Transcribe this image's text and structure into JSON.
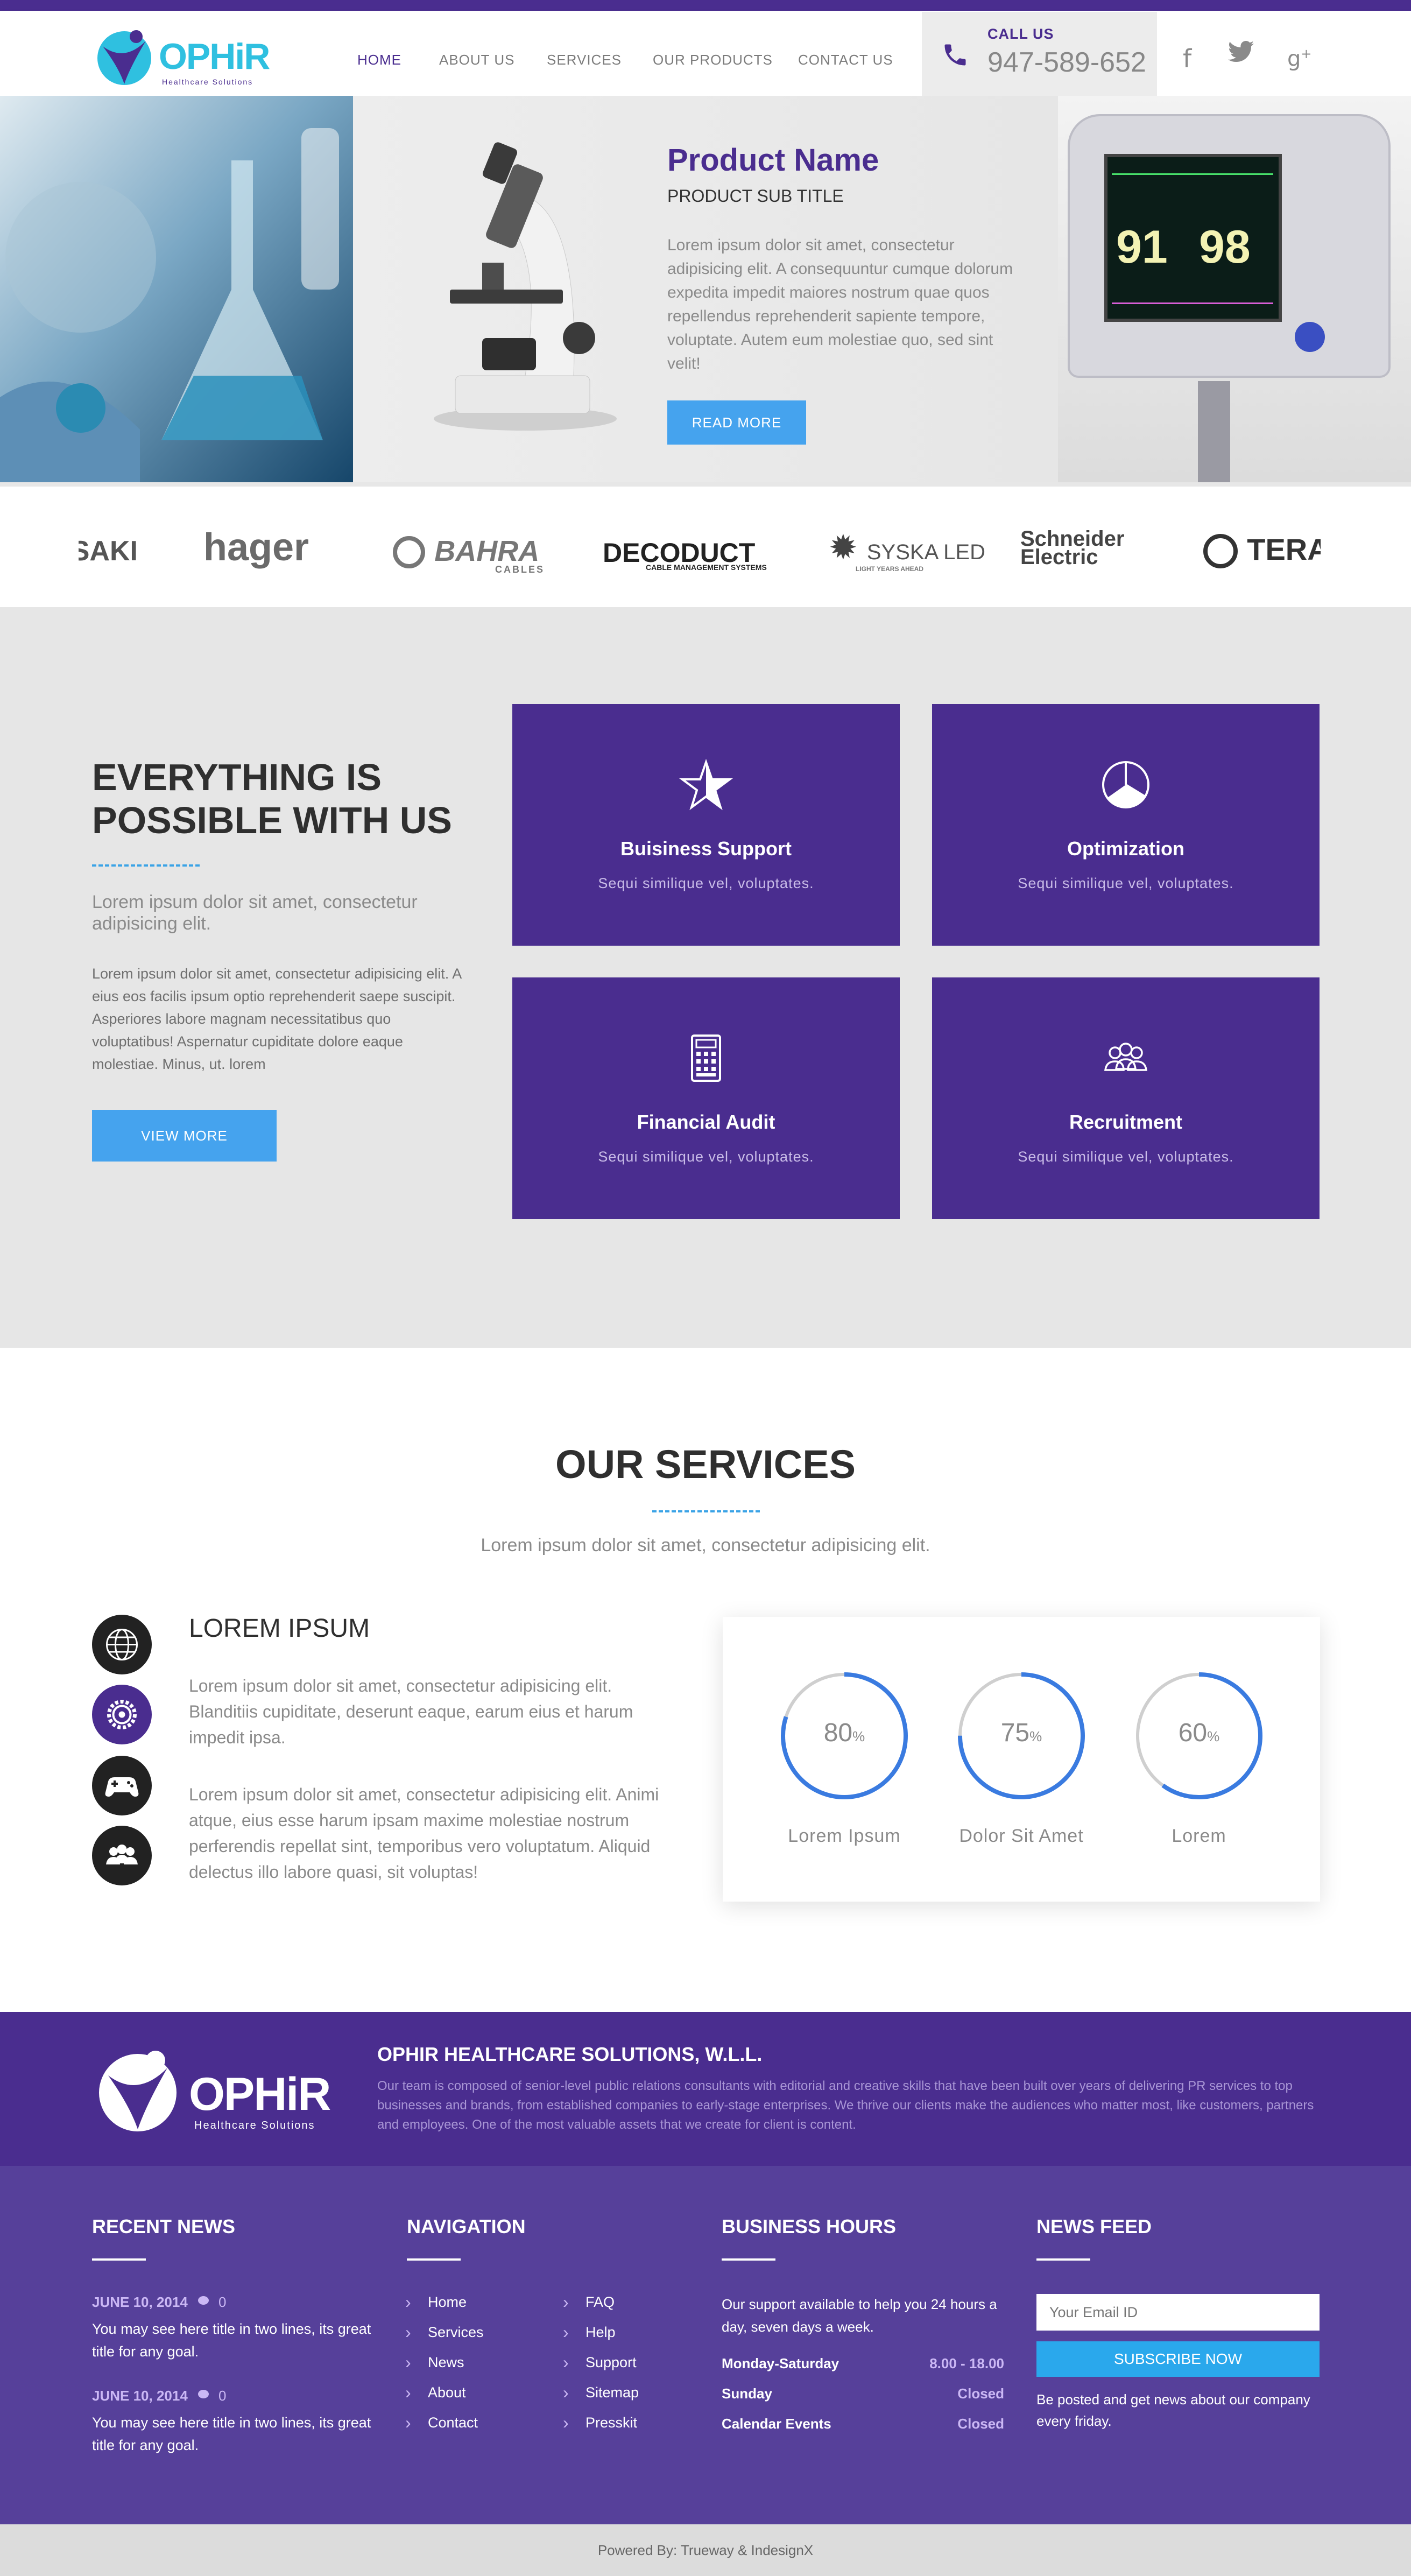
{
  "header": {
    "logo_text": "OPHiR",
    "logo_tagline": "Healthcare Solutions",
    "nav": [
      {
        "label": "HOME"
      },
      {
        "label": "ABOUT US"
      },
      {
        "label": "SERVICES"
      },
      {
        "label": "OUR PRODUCTS"
      },
      {
        "label": "CONTACT US"
      }
    ],
    "call_label": "CALL US",
    "phone": "947-589-652",
    "social": [
      "facebook-icon",
      "twitter-icon",
      "google-plus-icon"
    ]
  },
  "hero": {
    "title": "Product Name",
    "subtitle": "PRODUCT SUB TITLE",
    "body": "Lorem ipsum dolor sit amet, consectetur adipisicing elit. A consequuntur cumque dolorum expedita impedit maiores nostrum quae quos repellendus reprehenderit sapiente tempore, voluptate. Autem eum molestiae quo, sed sint velit!",
    "button": "READ MORE",
    "monitor_values": [
      "91",
      "98"
    ]
  },
  "brands": [
    "SAKI",
    "hager",
    "BAHRA",
    "DECODUCT",
    "SYSKA LED",
    "Schneider Electric",
    "TERAS"
  ],
  "brand_subtexts": {
    "bahra": "CABLES",
    "decoduct": "CABLE MANAGEMENT SYSTEMS",
    "syska": "LIGHT YEARS AHEAD"
  },
  "about": {
    "heading_line1": "EVERYTHING IS",
    "heading_line2": "POSSIBLE WITH US",
    "lead": "Lorem ipsum dolor sit amet, consectetur adipisicing elit.",
    "body": "Lorem ipsum dolor sit amet, consectetur adipisicing elit. A eius eos facilis ipsum optio reprehenderit saepe suscipit. Asperiores labore magnam necessitatibus quo voluptatibus! Aspernatur cupiditate dolore eaque molestiae. Minus, ut. lorem",
    "button": "VIEW MORE",
    "cards": [
      {
        "icon": "star-icon",
        "title": "Buisiness Support",
        "text": "Sequi similique vel, voluptates."
      },
      {
        "icon": "pie-chart-icon",
        "title": "Optimization",
        "text": "Sequi similique vel, voluptates."
      },
      {
        "icon": "calculator-icon",
        "title": "Financial Audit",
        "text": "Sequi similique vel, voluptates."
      },
      {
        "icon": "people-icon",
        "title": "Recruitment",
        "text": "Sequi similique vel, voluptates."
      }
    ]
  },
  "services": {
    "title": "OUR SERVICES",
    "lead": "Lorem ipsum dolor sit amet, consectetur adipisicing elit.",
    "icons": [
      "globe-icon",
      "settings-icon",
      "gamepad-icon",
      "group-icon"
    ],
    "heading": "LOREM IPSUM",
    "para1": "Lorem ipsum dolor sit amet, consectetur adipisicing elit. Blanditiis cupiditate, deserunt eaque, earum eius et harum impedit ipsa.",
    "para2": "Lorem ipsum dolor sit amet, consectetur adipisicing elit. Animi atque, eius esse harum ipsam maxime molestiae nostrum perferendis repellat sint, temporibus vero voluptatum. Aliquid delectus illo labore quasi, sit voluptas!",
    "stats": [
      {
        "value": 80,
        "unit": "%",
        "label": "Lorem Ipsum"
      },
      {
        "value": 75,
        "unit": "%",
        "label": "Dolor Sit Amet"
      },
      {
        "value": 60,
        "unit": "%",
        "label": "Lorem"
      }
    ]
  },
  "footer_top": {
    "logo_text": "OPHiR",
    "logo_tagline": "Healthcare Solutions",
    "company": "OPHIR HEALTHCARE SOLUTIONS, W.L.L.",
    "about": "Our team is composed of senior-level public relations consultants with editorial and creative skills that have been built over years of delivering PR services to top businesses and brands, from established companies to early-stage enterprises. We thrive our clients make the audiences who matter most, like customers, partners and employees. One of the most valuable assets that we create for client is content."
  },
  "footer": {
    "recent_news_title": "RECENT NEWS",
    "news": [
      {
        "date": "JUNE 10, 2014",
        "comments": "0",
        "text": "You may see here title in two lines, its great title for any goal."
      },
      {
        "date": "JUNE 10, 2014",
        "comments": "0",
        "text": "You may see here title in two lines, its great title for any goal."
      }
    ],
    "navigation_title": "NAVIGATION",
    "nav_col1": [
      "Home",
      "Services",
      "News",
      "About",
      "Contact"
    ],
    "nav_col2": [
      "FAQ",
      "Help",
      "Support",
      "Sitemap",
      "Presskit"
    ],
    "hours_title": "BUSINESS HOURS",
    "hours_intro": "Our support available to help you 24 hours a day, seven days a week.",
    "hours": [
      {
        "day": "Monday-Saturday",
        "time": "8.00 - 18.00"
      },
      {
        "day": "Sunday",
        "time": "Closed"
      },
      {
        "day": "Calendar Events",
        "time": "Closed"
      }
    ],
    "newsfeed_title": "NEWS FEED",
    "email_placeholder": "Your Email ID",
    "subscribe": "SUBSCRIBE NOW",
    "newsfeed_text": "Be posted and get news about our company every friday."
  },
  "powered_by": "Powered By: Trueway & IndesignX",
  "colors": {
    "brand_purple": "#4a2d8f",
    "footer_purple": "#56409a",
    "accent_blue": "#45a3ee",
    "logo_cyan": "#2fc0e0",
    "progress_blue": "#3a7be0"
  }
}
